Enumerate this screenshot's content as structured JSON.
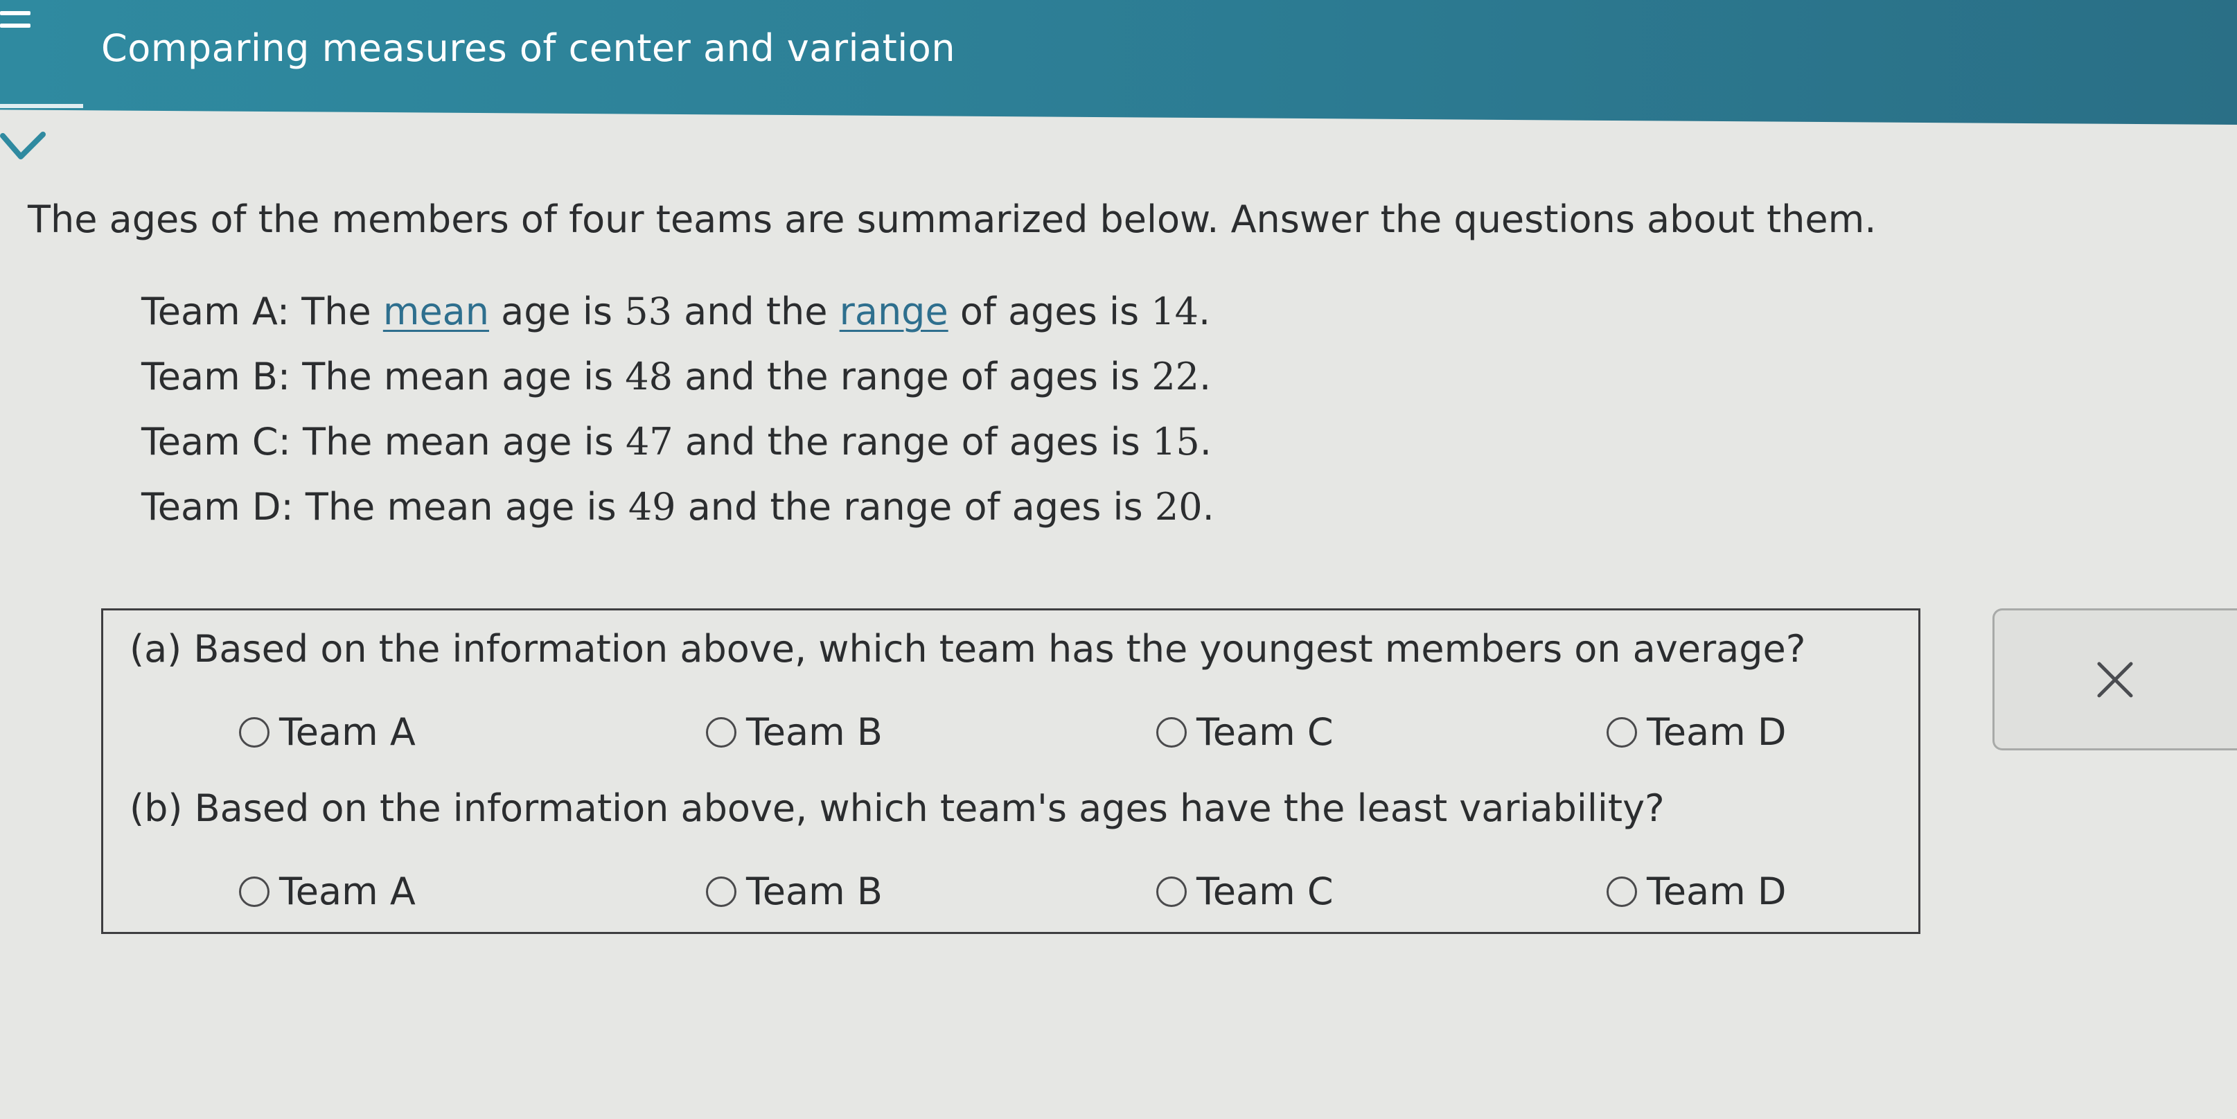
{
  "header": {
    "title": "Comparing measures of center and variation"
  },
  "problem": {
    "intro": "The ages of the members of four teams are summarized below. Answer the questions about them.",
    "teams": [
      {
        "prefix": "Team A: The ",
        "mean_word": "mean",
        "mid": " age is ",
        "mean": "53",
        "and": " and the ",
        "range_word": "range",
        "tail": " of ages is ",
        "range": "14",
        "end": "."
      },
      {
        "prefix": "Team B: The ",
        "mean_word": "mean",
        "mid": " age is ",
        "mean": "48",
        "and": " and the ",
        "range_word": "range",
        "tail": " of ages is ",
        "range": "22",
        "end": "."
      },
      {
        "prefix": "Team C: The ",
        "mean_word": "mean",
        "mid": " age is ",
        "mean": "47",
        "and": " and the ",
        "range_word": "range",
        "tail": " of ages is ",
        "range": "15",
        "end": "."
      },
      {
        "prefix": "Team D: The ",
        "mean_word": "mean",
        "mid": " age is ",
        "mean": "49",
        "and": " and the ",
        "range_word": "range",
        "tail": " of ages is ",
        "range": "20",
        "end": "."
      }
    ]
  },
  "questions": [
    {
      "text": "(a) Based on the information above, which team has the youngest members on average?",
      "options": [
        "Team A",
        "Team B",
        "Team C",
        "Team D"
      ]
    },
    {
      "text": "(b) Based on the information above, which team's ages have the least variability?",
      "options": [
        "Team A",
        "Team B",
        "Team C",
        "Team D"
      ]
    }
  ],
  "icons": {
    "menu": "menu-icon",
    "collapse": "chevron-down-icon",
    "close": "close-icon"
  },
  "colors": {
    "header": "#2d7f96",
    "link": "#2e6f8e"
  }
}
